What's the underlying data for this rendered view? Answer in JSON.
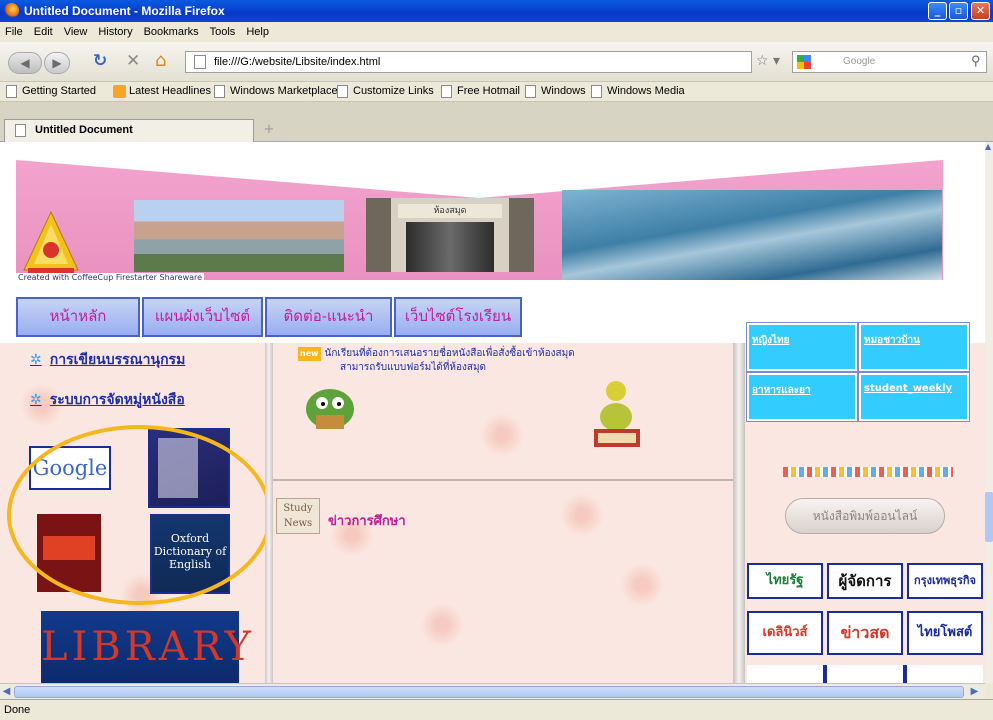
{
  "window": {
    "title": "Untitled Document - Mozilla Firefox",
    "minimize": "_",
    "maximize": "▫",
    "close": "✕"
  },
  "menu": [
    "File",
    "Edit",
    "View",
    "History",
    "Bookmarks",
    "Tools",
    "Help"
  ],
  "nav": {
    "url": "file:///G:/website/Libsite/index.html",
    "search_placeholder": "Google"
  },
  "bookmarks": [
    "Getting Started",
    "Latest Headlines",
    "Windows Marketplace",
    "Customize Links",
    "Free Hotmail",
    "Windows",
    "Windows Media"
  ],
  "tab": {
    "title": "Untitled Document",
    "new_tab": "+"
  },
  "page": {
    "banner_caption": "Created with CoffeeCup Firestarter Shareware",
    "library_sign": "ห้องสมุด",
    "nav_links": [
      "หน้าหลัก",
      "แผนผังเว็บไซต์",
      "ติดต่อ-แนะนำ",
      "เว็บไซต์โรงเรียน"
    ],
    "left_links": [
      "การเขียนบรรณานุกรม",
      "ระบบการจัดหมู่หนังสือ"
    ],
    "google": "Google",
    "dictionary": "Oxford Dictionary of English",
    "library_word": "LIBRARY",
    "mid_notice_1": "นักเรียนที่ต้องการเสนอรายชื่อหนังสือเพื่อสั่งซื้อเข้าห้องสมุด",
    "mid_notice_2": "สามารถรับแบบฟอร์มได้ที่ห้องสมุด",
    "study_news_label": "Study News",
    "edu_news": "ข่าวการศึกษา",
    "right_cells": [
      "หญิงไทย",
      "หมอชาวบ้าน",
      "อาหารและยา",
      "student_weekly"
    ],
    "online_news": "หนังสือพิมพ์ออนไลน์",
    "newspapers": [
      "ไทยรัฐ",
      "ผู้จัดการ",
      "กรุงเทพธุรกิจ",
      "เดลินิวส์",
      "ข่าวสด",
      "ไทยโพสต์"
    ]
  },
  "status": "Done"
}
